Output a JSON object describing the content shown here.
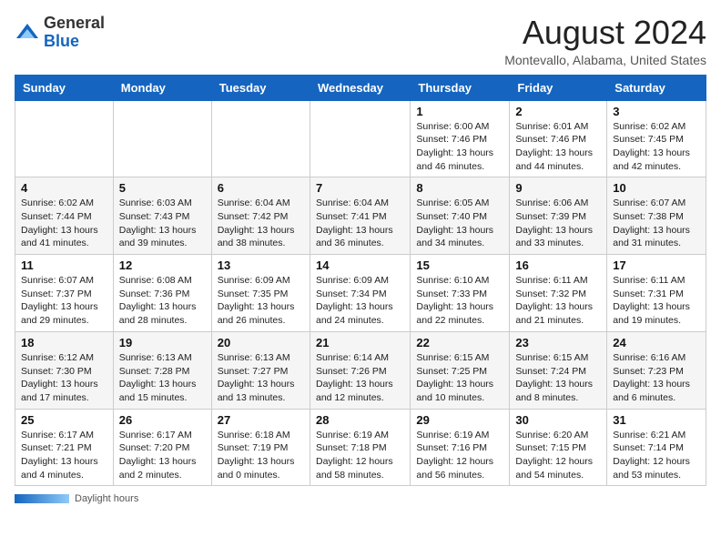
{
  "header": {
    "logo_general": "General",
    "logo_blue": "Blue",
    "month_title": "August 2024",
    "location": "Montevallo, Alabama, United States"
  },
  "days_of_week": [
    "Sunday",
    "Monday",
    "Tuesday",
    "Wednesday",
    "Thursday",
    "Friday",
    "Saturday"
  ],
  "weeks": [
    [
      {
        "day": "",
        "info": ""
      },
      {
        "day": "",
        "info": ""
      },
      {
        "day": "",
        "info": ""
      },
      {
        "day": "",
        "info": ""
      },
      {
        "day": "1",
        "info": "Sunrise: 6:00 AM\nSunset: 7:46 PM\nDaylight: 13 hours\nand 46 minutes."
      },
      {
        "day": "2",
        "info": "Sunrise: 6:01 AM\nSunset: 7:46 PM\nDaylight: 13 hours\nand 44 minutes."
      },
      {
        "day": "3",
        "info": "Sunrise: 6:02 AM\nSunset: 7:45 PM\nDaylight: 13 hours\nand 42 minutes."
      }
    ],
    [
      {
        "day": "4",
        "info": "Sunrise: 6:02 AM\nSunset: 7:44 PM\nDaylight: 13 hours\nand 41 minutes."
      },
      {
        "day": "5",
        "info": "Sunrise: 6:03 AM\nSunset: 7:43 PM\nDaylight: 13 hours\nand 39 minutes."
      },
      {
        "day": "6",
        "info": "Sunrise: 6:04 AM\nSunset: 7:42 PM\nDaylight: 13 hours\nand 38 minutes."
      },
      {
        "day": "7",
        "info": "Sunrise: 6:04 AM\nSunset: 7:41 PM\nDaylight: 13 hours\nand 36 minutes."
      },
      {
        "day": "8",
        "info": "Sunrise: 6:05 AM\nSunset: 7:40 PM\nDaylight: 13 hours\nand 34 minutes."
      },
      {
        "day": "9",
        "info": "Sunrise: 6:06 AM\nSunset: 7:39 PM\nDaylight: 13 hours\nand 33 minutes."
      },
      {
        "day": "10",
        "info": "Sunrise: 6:07 AM\nSunset: 7:38 PM\nDaylight: 13 hours\nand 31 minutes."
      }
    ],
    [
      {
        "day": "11",
        "info": "Sunrise: 6:07 AM\nSunset: 7:37 PM\nDaylight: 13 hours\nand 29 minutes."
      },
      {
        "day": "12",
        "info": "Sunrise: 6:08 AM\nSunset: 7:36 PM\nDaylight: 13 hours\nand 28 minutes."
      },
      {
        "day": "13",
        "info": "Sunrise: 6:09 AM\nSunset: 7:35 PM\nDaylight: 13 hours\nand 26 minutes."
      },
      {
        "day": "14",
        "info": "Sunrise: 6:09 AM\nSunset: 7:34 PM\nDaylight: 13 hours\nand 24 minutes."
      },
      {
        "day": "15",
        "info": "Sunrise: 6:10 AM\nSunset: 7:33 PM\nDaylight: 13 hours\nand 22 minutes."
      },
      {
        "day": "16",
        "info": "Sunrise: 6:11 AM\nSunset: 7:32 PM\nDaylight: 13 hours\nand 21 minutes."
      },
      {
        "day": "17",
        "info": "Sunrise: 6:11 AM\nSunset: 7:31 PM\nDaylight: 13 hours\nand 19 minutes."
      }
    ],
    [
      {
        "day": "18",
        "info": "Sunrise: 6:12 AM\nSunset: 7:30 PM\nDaylight: 13 hours\nand 17 minutes."
      },
      {
        "day": "19",
        "info": "Sunrise: 6:13 AM\nSunset: 7:28 PM\nDaylight: 13 hours\nand 15 minutes."
      },
      {
        "day": "20",
        "info": "Sunrise: 6:13 AM\nSunset: 7:27 PM\nDaylight: 13 hours\nand 13 minutes."
      },
      {
        "day": "21",
        "info": "Sunrise: 6:14 AM\nSunset: 7:26 PM\nDaylight: 13 hours\nand 12 minutes."
      },
      {
        "day": "22",
        "info": "Sunrise: 6:15 AM\nSunset: 7:25 PM\nDaylight: 13 hours\nand 10 minutes."
      },
      {
        "day": "23",
        "info": "Sunrise: 6:15 AM\nSunset: 7:24 PM\nDaylight: 13 hours\nand 8 minutes."
      },
      {
        "day": "24",
        "info": "Sunrise: 6:16 AM\nSunset: 7:23 PM\nDaylight: 13 hours\nand 6 minutes."
      }
    ],
    [
      {
        "day": "25",
        "info": "Sunrise: 6:17 AM\nSunset: 7:21 PM\nDaylight: 13 hours\nand 4 minutes."
      },
      {
        "day": "26",
        "info": "Sunrise: 6:17 AM\nSunset: 7:20 PM\nDaylight: 13 hours\nand 2 minutes."
      },
      {
        "day": "27",
        "info": "Sunrise: 6:18 AM\nSunset: 7:19 PM\nDaylight: 13 hours\nand 0 minutes."
      },
      {
        "day": "28",
        "info": "Sunrise: 6:19 AM\nSunset: 7:18 PM\nDaylight: 12 hours\nand 58 minutes."
      },
      {
        "day": "29",
        "info": "Sunrise: 6:19 AM\nSunset: 7:16 PM\nDaylight: 12 hours\nand 56 minutes."
      },
      {
        "day": "30",
        "info": "Sunrise: 6:20 AM\nSunset: 7:15 PM\nDaylight: 12 hours\nand 54 minutes."
      },
      {
        "day": "31",
        "info": "Sunrise: 6:21 AM\nSunset: 7:14 PM\nDaylight: 12 hours\nand 53 minutes."
      }
    ]
  ],
  "footer": {
    "daylight_label": "Daylight hours"
  }
}
